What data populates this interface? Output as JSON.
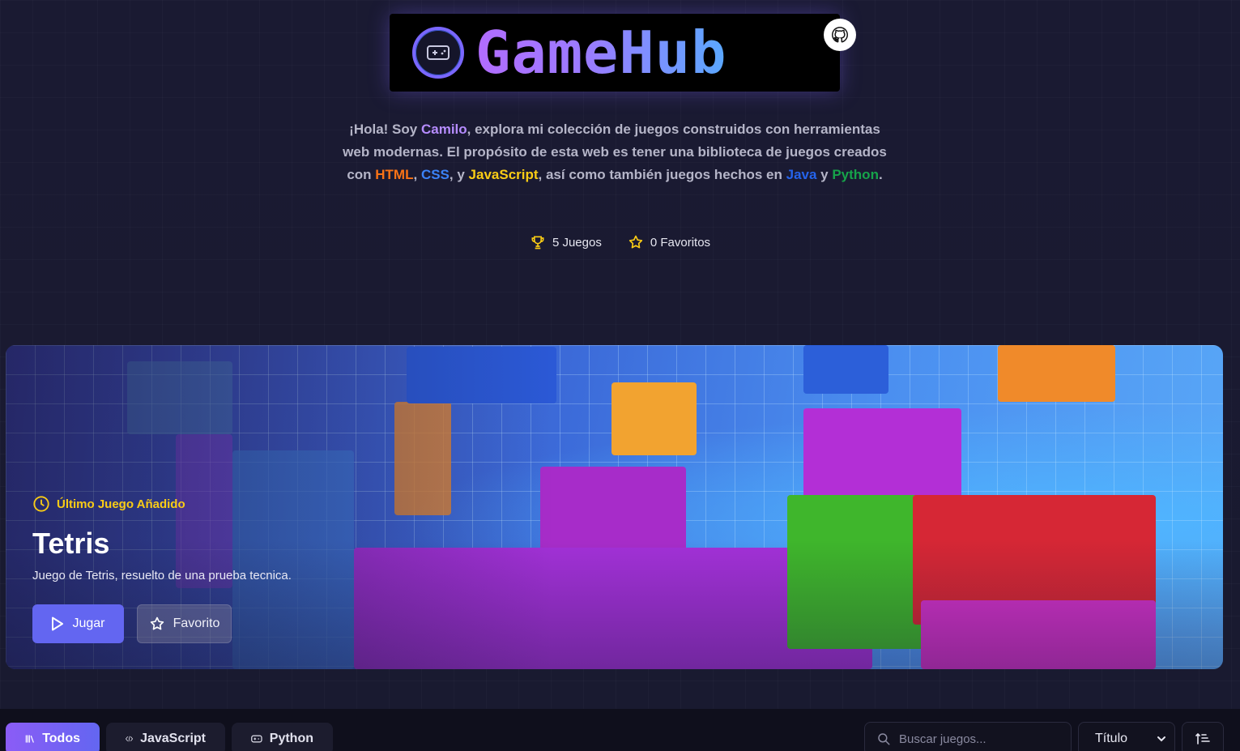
{
  "logo": {
    "title": "GameHub",
    "github_icon": "github-icon",
    "gamepad_icon": "gamepad-icon"
  },
  "intro": {
    "p1": "¡Hola! Soy ",
    "name": "Camilo",
    "p2": ", explora mi colección de juegos construidos con herramientas web modernas. El propósito de esta web es tener una biblioteca de juegos creados con ",
    "html": "HTML",
    "sep1": ", ",
    "css": "CSS",
    "sep2": ", y ",
    "js": "JavaScript",
    "p3": ", así como también juegos hechos en ",
    "java": "Java",
    "sep3": " y ",
    "python": "Python",
    "end": "."
  },
  "stats": {
    "games": "5 Juegos",
    "favorites": "0 Favoritos"
  },
  "hero": {
    "badge": "Último Juego Añadido",
    "title": "Tetris",
    "description": "Juego de Tetris, resuelto de una prueba tecnica.",
    "play_label": "Jugar",
    "favorite_label": "Favorito"
  },
  "filters": {
    "tabs": [
      {
        "label": "Todos",
        "icon": "library-icon",
        "active": true
      },
      {
        "label": "JavaScript",
        "icon": "code-icon",
        "active": false
      },
      {
        "label": "Python",
        "icon": "gamepad-icon",
        "active": false
      }
    ],
    "search_placeholder": "Buscar juegos...",
    "sort_selected": "Título"
  },
  "colors": {
    "accent": "#6366f1",
    "name": "#b68cff",
    "html": "#f97316",
    "css": "#3b82f6",
    "js": "#facc15",
    "java": "#2563eb",
    "python": "#16a34a"
  }
}
